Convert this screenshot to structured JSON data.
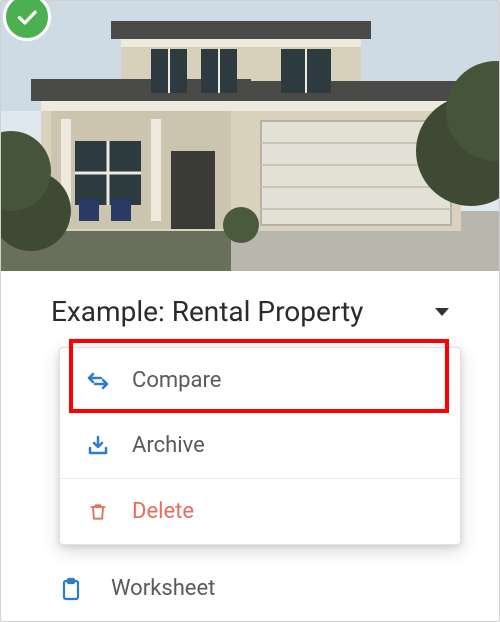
{
  "badge": {
    "status": "checked"
  },
  "title": "Example: Rental Property",
  "menu": {
    "compare": "Compare",
    "archive": "Archive",
    "delete": "Delete"
  },
  "extra": {
    "worksheet": "Worksheet"
  },
  "colors": {
    "accentBlue": "#2a7bd6",
    "delete": "#e86b5c",
    "badge": "#4CAF50"
  }
}
